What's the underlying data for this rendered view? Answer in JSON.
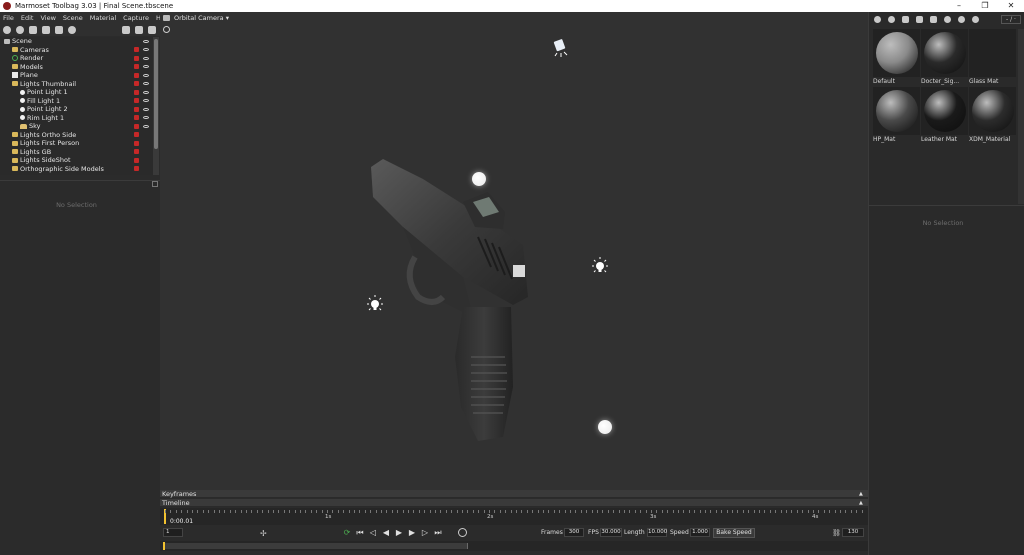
{
  "window": {
    "title": "Marmoset Toolbag 3.03  |  Final Scene.tbscene",
    "controls": [
      "–",
      "❐",
      "✕"
    ]
  },
  "menu": [
    "File",
    "Edit",
    "View",
    "Scene",
    "Material",
    "Capture",
    "Help"
  ],
  "scene_tree": {
    "rows": [
      {
        "label": "Scene",
        "icon": "scene-icon"
      },
      {
        "label": "Cameras",
        "icon": "folder-icon"
      },
      {
        "label": "Render",
        "icon": "render-icon"
      },
      {
        "label": "Models",
        "icon": "folder-icon"
      },
      {
        "label": "Plane",
        "icon": "plane-icon"
      },
      {
        "label": "Lights Thumbnail",
        "icon": "folder-icon"
      },
      {
        "label": "Point Light 1",
        "icon": "bulb-icon"
      },
      {
        "label": "Fill Light 1",
        "icon": "bulb-icon"
      },
      {
        "label": "Point Light 2",
        "icon": "bulb-icon"
      },
      {
        "label": "Rim Light 1",
        "icon": "bulb-icon"
      },
      {
        "label": "Sky",
        "icon": "sky-icon"
      },
      {
        "label": "Lights Ortho Side",
        "icon": "folder-icon"
      },
      {
        "label": "Lights First Person",
        "icon": "folder-icon"
      },
      {
        "label": "Lights GB",
        "icon": "folder-icon"
      },
      {
        "label": "Lights SideShot",
        "icon": "folder-icon"
      },
      {
        "label": "Orthographic Side Models",
        "icon": "folder-icon"
      }
    ]
  },
  "left_props": {
    "empty_text": "No Selection"
  },
  "viewport": {
    "camera_label": "Orbital Camera ▾"
  },
  "materials": {
    "zoom": "- / ·",
    "items": [
      {
        "name": "Default",
        "color": "#8a8a8a"
      },
      {
        "name": "Docter_Sig...",
        "color": "#2a2a2a"
      },
      {
        "name": "Glass Mat",
        "color": "#2f2f2f"
      },
      {
        "name": "HP_Mat",
        "color": "#4a4a4a"
      },
      {
        "name": "Leather Mat",
        "color": "#1a1a1a"
      },
      {
        "name": "XDM_Material",
        "color": "#2c2c2c"
      }
    ],
    "empty_text": "No Selection"
  },
  "timeline": {
    "keyframes_label": "Keyframes",
    "timeline_label": "Timeline",
    "ruler_labels": [
      "1s",
      "2s",
      "3s",
      "4s"
    ],
    "current_time": "0:00.01",
    "current_frame": "1",
    "frames_label": "Frames",
    "frames_value": "300",
    "fps_label": "FPS",
    "fps_value": "30.000",
    "length_label": "Length",
    "length_value": "10.000",
    "speed_label": "Speed",
    "speed_value": "1.000",
    "bake_label": "Bake Speed",
    "end_frame": "130"
  }
}
